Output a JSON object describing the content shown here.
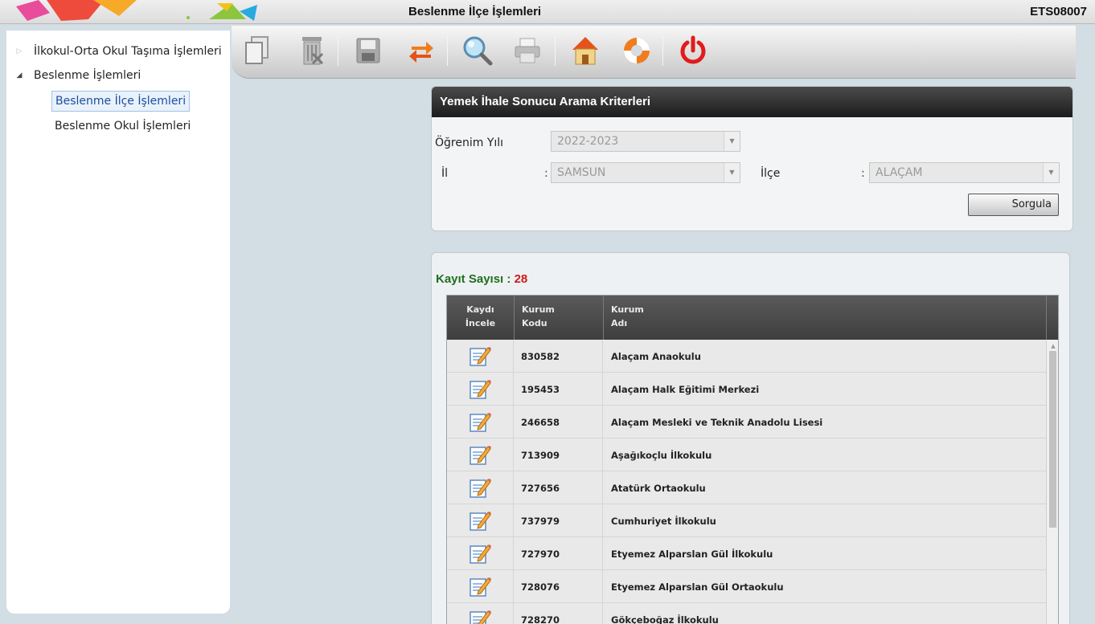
{
  "header": {
    "title": "Beslenme İlçe İşlemleri",
    "code": "ETS08007"
  },
  "sidebar": {
    "items": [
      {
        "label": "İlkokul-Orta Okul Taşıma İşlemleri",
        "expanded": false
      },
      {
        "label": "Beslenme İşlemleri",
        "expanded": true,
        "children": [
          {
            "label": "Beslenme İlçe İşlemleri",
            "selected": true
          },
          {
            "label": "Beslenme Okul İşlemleri",
            "selected": false
          }
        ]
      }
    ]
  },
  "toolbar": {
    "buttons": [
      "copy-icon",
      "delete-icon",
      "save-icon",
      "refresh-icon",
      "search-icon",
      "print-icon",
      "home-icon",
      "help-lifebuoy-icon",
      "power-icon"
    ]
  },
  "criteria": {
    "title": "Yemek İhale Sonucu Arama Kriterleri",
    "year_label": "Öğrenim Yılı",
    "year_value": "2022-2023",
    "il_label": "İl",
    "il_value": "SAMSUN",
    "ilce_label": "İlçe",
    "ilce_value": "ALAÇAM",
    "colon": ":",
    "search_button": "Sorgula"
  },
  "results": {
    "count_label": "Kayıt Sayısı :",
    "count_value": "28",
    "columns": {
      "c1_line1": "Kaydı",
      "c1_line2": "İncele",
      "c2_line1": "Kurum",
      "c2_line2": "Kodu",
      "c3_line1": "Kurum",
      "c3_line2": "Adı"
    },
    "rows": [
      {
        "code": "830582",
        "name": "Alaçam Anaokulu"
      },
      {
        "code": "195453",
        "name": "Alaçam Halk Eğitimi Merkezi"
      },
      {
        "code": "246658",
        "name": "Alaçam Mesleki ve Teknik Anadolu Lisesi"
      },
      {
        "code": "713909",
        "name": "Aşağıkoçlu İlkokulu"
      },
      {
        "code": "727656",
        "name": "Atatürk Ortaokulu"
      },
      {
        "code": "737979",
        "name": "Cumhuriyet İlkokulu"
      },
      {
        "code": "727970",
        "name": "Etyemez Alparslan Gül İlkokulu"
      },
      {
        "code": "728076",
        "name": "Etyemez Alparslan Gül Ortaokulu"
      },
      {
        "code": "728270",
        "name": "Gökçeboğaz İlkokulu"
      }
    ]
  }
}
